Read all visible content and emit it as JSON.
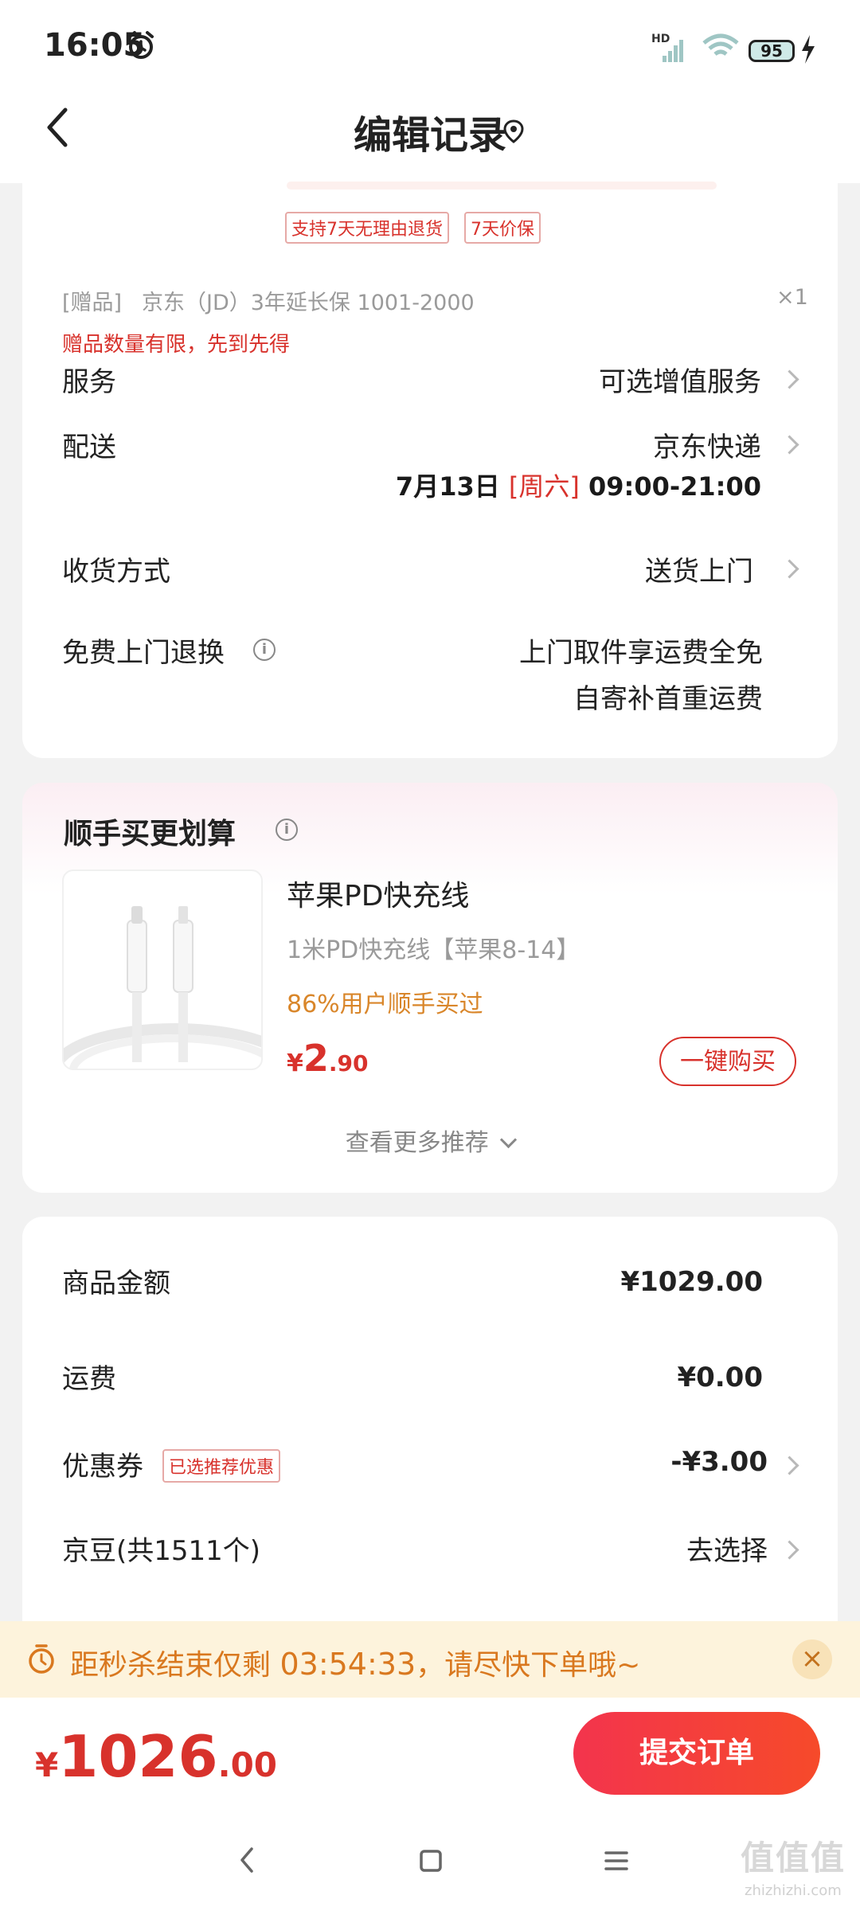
{
  "status": {
    "time": "16:05",
    "network": "HD",
    "wifi_label": "6",
    "battery": "95"
  },
  "header": {
    "title": "编辑记录"
  },
  "product": {
    "service_tags": [
      "支持7天无理由退货",
      "7天价保"
    ],
    "gift_prefix": "[赠品]",
    "gift_name": "京东（JD）3年延长保 1001-2000",
    "gift_qty": "×1",
    "gift_note": "赠品数量有限，先到先得"
  },
  "rows": {
    "service": {
      "label": "服务",
      "value": "可选增值服务"
    },
    "delivery": {
      "label": "配送",
      "value": "京东快递",
      "date": "7月13日",
      "weekday": "[周六]",
      "time": "09:00-21:00"
    },
    "receive": {
      "label": "收货方式",
      "value": "送货上门"
    },
    "free_return": {
      "label": "免费上门退换",
      "line1": "上门取件享运费全免",
      "line2": "自寄补首重运费"
    }
  },
  "recommend": {
    "title": "顺手买更划算",
    "item": {
      "name": "苹果PD快充线",
      "spec": "1米PD快充线【苹果8-14】",
      "social": "86%用户顺手买过",
      "currency": "¥",
      "price_int": "2",
      "price_dec": ".90",
      "button": "一键购买"
    },
    "more": "查看更多推荐"
  },
  "summary": {
    "goods": {
      "label": "商品金额",
      "value": "¥1029.00"
    },
    "shipping": {
      "label": "运费",
      "value": "¥0.00"
    },
    "coupon": {
      "label": "优惠券",
      "tag": "已选推荐优惠",
      "value": "-¥3.00"
    },
    "beans": {
      "label": "京豆(共1511个)",
      "value": "去选择"
    }
  },
  "seckill": {
    "text": "距秒杀结束仅剩",
    "countdown": "03:54:33",
    "suffix": "，请尽快下单哦~"
  },
  "bottom": {
    "currency": "¥",
    "total_int": "1026",
    "total_dec": ".00",
    "submit": "提交订单"
  },
  "watermark": {
    "text": "值值值",
    "sub": "zhizhizhi.com"
  },
  "colors": {
    "accent": "#d8322c",
    "warning": "#d9781f",
    "submit_gradient_start": "#f3344d",
    "submit_gradient_end": "#f64a2a"
  }
}
